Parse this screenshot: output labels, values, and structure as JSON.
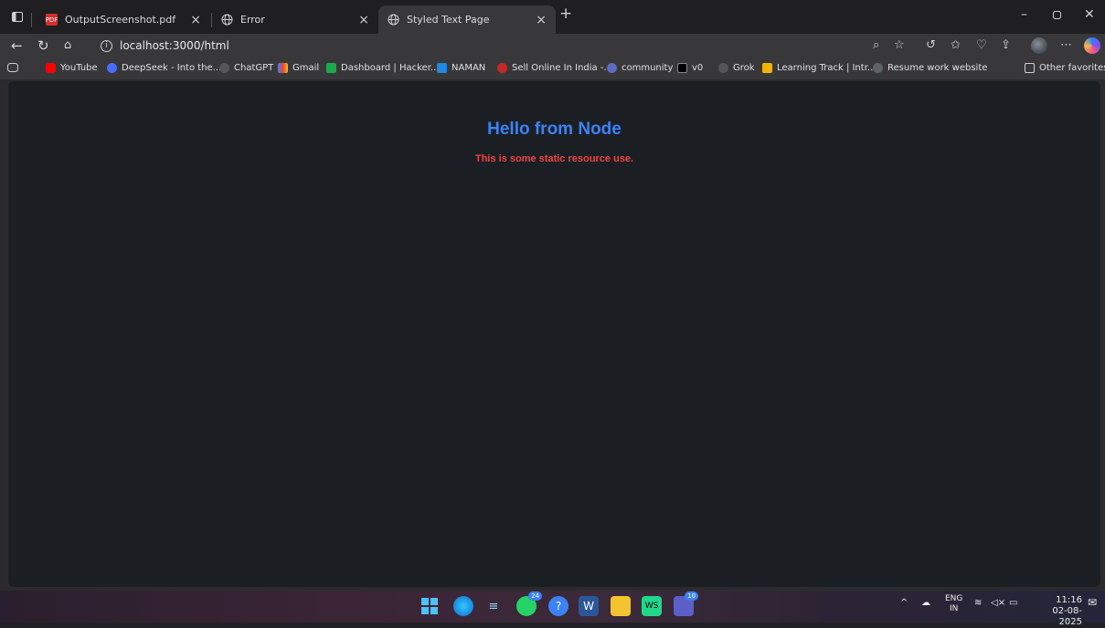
{
  "browser": {
    "tabs": [
      {
        "title": "OutputScreenshot.pdf",
        "icon": "pdf-icon"
      },
      {
        "title": "Error",
        "icon": "globe-icon"
      },
      {
        "title": "Styled Text Page",
        "icon": "globe-icon",
        "active": true
      }
    ],
    "address": "localhost:3000/html",
    "bookmarks": [
      {
        "label": "YouTube",
        "color": "#ff0000"
      },
      {
        "label": "DeepSeek - Into the...",
        "color": "#4d6bfe"
      },
      {
        "label": "ChatGPT",
        "color": "#3a3a3a"
      },
      {
        "label": "Gmail",
        "color": "#ea4335"
      },
      {
        "label": "Dashboard | Hacker...",
        "color": "#1ba94c"
      },
      {
        "label": "NAMAN",
        "color": "#1e88e5"
      },
      {
        "label": "Sell Online In India -...",
        "color": "#c62828"
      },
      {
        "label": "community",
        "color": "#5c6bc0"
      },
      {
        "label": "v0",
        "color": "#000000"
      },
      {
        "label": "Grok",
        "color": "#555555"
      },
      {
        "label": "Learning Track | Intr...",
        "color": "#f4b400"
      },
      {
        "label": "Resume work website",
        "color": "#5f6368"
      }
    ],
    "other_favorites": "Other favorites"
  },
  "page": {
    "heading": "Hello from Node",
    "heading_color": "#3b82f6",
    "paragraph": "This is some static resource use.",
    "paragraph_color": "#ef4444"
  },
  "taskbar": {
    "whatsapp_badge": "24",
    "teams_badge": "10",
    "lang_top": "ENG",
    "lang_bottom": "IN",
    "time": "11:16",
    "date": "02-08-2025"
  }
}
